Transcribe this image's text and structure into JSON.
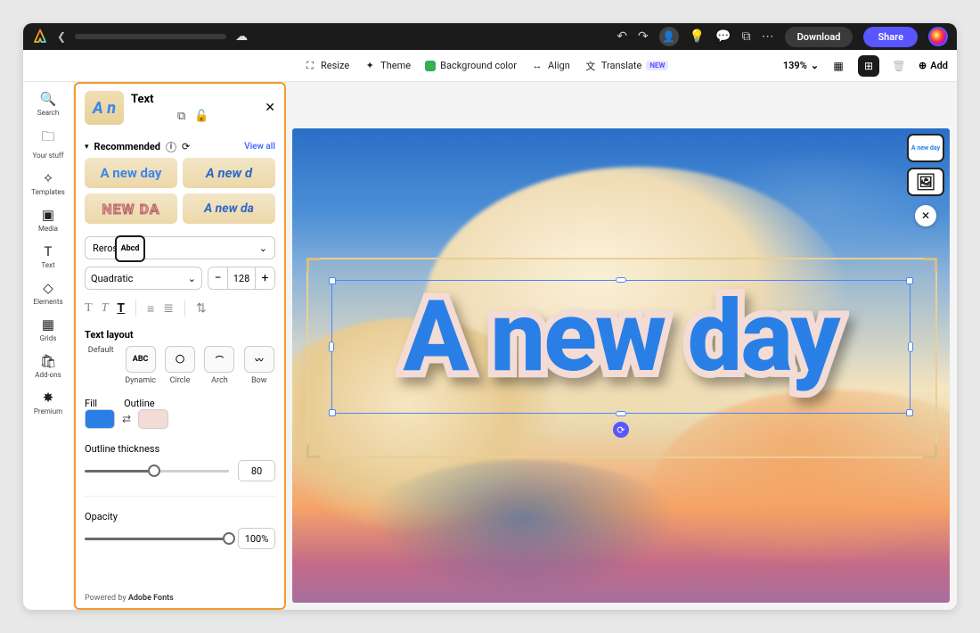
{
  "header": {
    "download": "Download",
    "share": "Share"
  },
  "toolbar": {
    "resize": "Resize",
    "theme": "Theme",
    "bgcolor": "Background color",
    "align": "Align",
    "translate": "Translate",
    "translate_badge": "NEW",
    "zoom": "139%",
    "add": "Add"
  },
  "rail": {
    "search": "Search",
    "your_stuff": "Your stuff",
    "templates": "Templates",
    "media": "Media",
    "text": "Text",
    "elements": "Elements",
    "grids": "Grids",
    "addons": "Add-ons",
    "premium": "Premium"
  },
  "panel": {
    "title": "Text",
    "thumb_text": "A n",
    "recommended": "Recommended",
    "view_all": "View all",
    "recs": {
      "r1": "A new day",
      "r2": "A new d",
      "r3": "NEW DA",
      "r4": "A new da"
    },
    "font_family": "Reross",
    "font_style": "Quadratic",
    "font_size": "128",
    "text_layout_label": "Text layout",
    "layouts": {
      "default": "Default",
      "dynamic": "Dynamic",
      "circle": "Circle",
      "arch": "Arch",
      "bow": "Bow"
    },
    "layout_box": {
      "default": "Abcd",
      "dynamic": "ABC"
    },
    "fill_label": "Fill",
    "outline_label": "Outline",
    "outline_thickness_label": "Outline thickness",
    "outline_thickness_value": "80",
    "opacity_label": "Opacity",
    "opacity_value": "100%",
    "footer_prefix": "Powered by ",
    "footer_brand": "Adobe Fonts"
  },
  "canvas": {
    "text": "A new day",
    "thumb_label": "A new day"
  },
  "colors": {
    "fill": "#2a7fe6",
    "outline": "#f3dbd6",
    "accent": "#5856ff",
    "panel_border": "#f29b2e",
    "bg_swatch": "#3cb043"
  }
}
